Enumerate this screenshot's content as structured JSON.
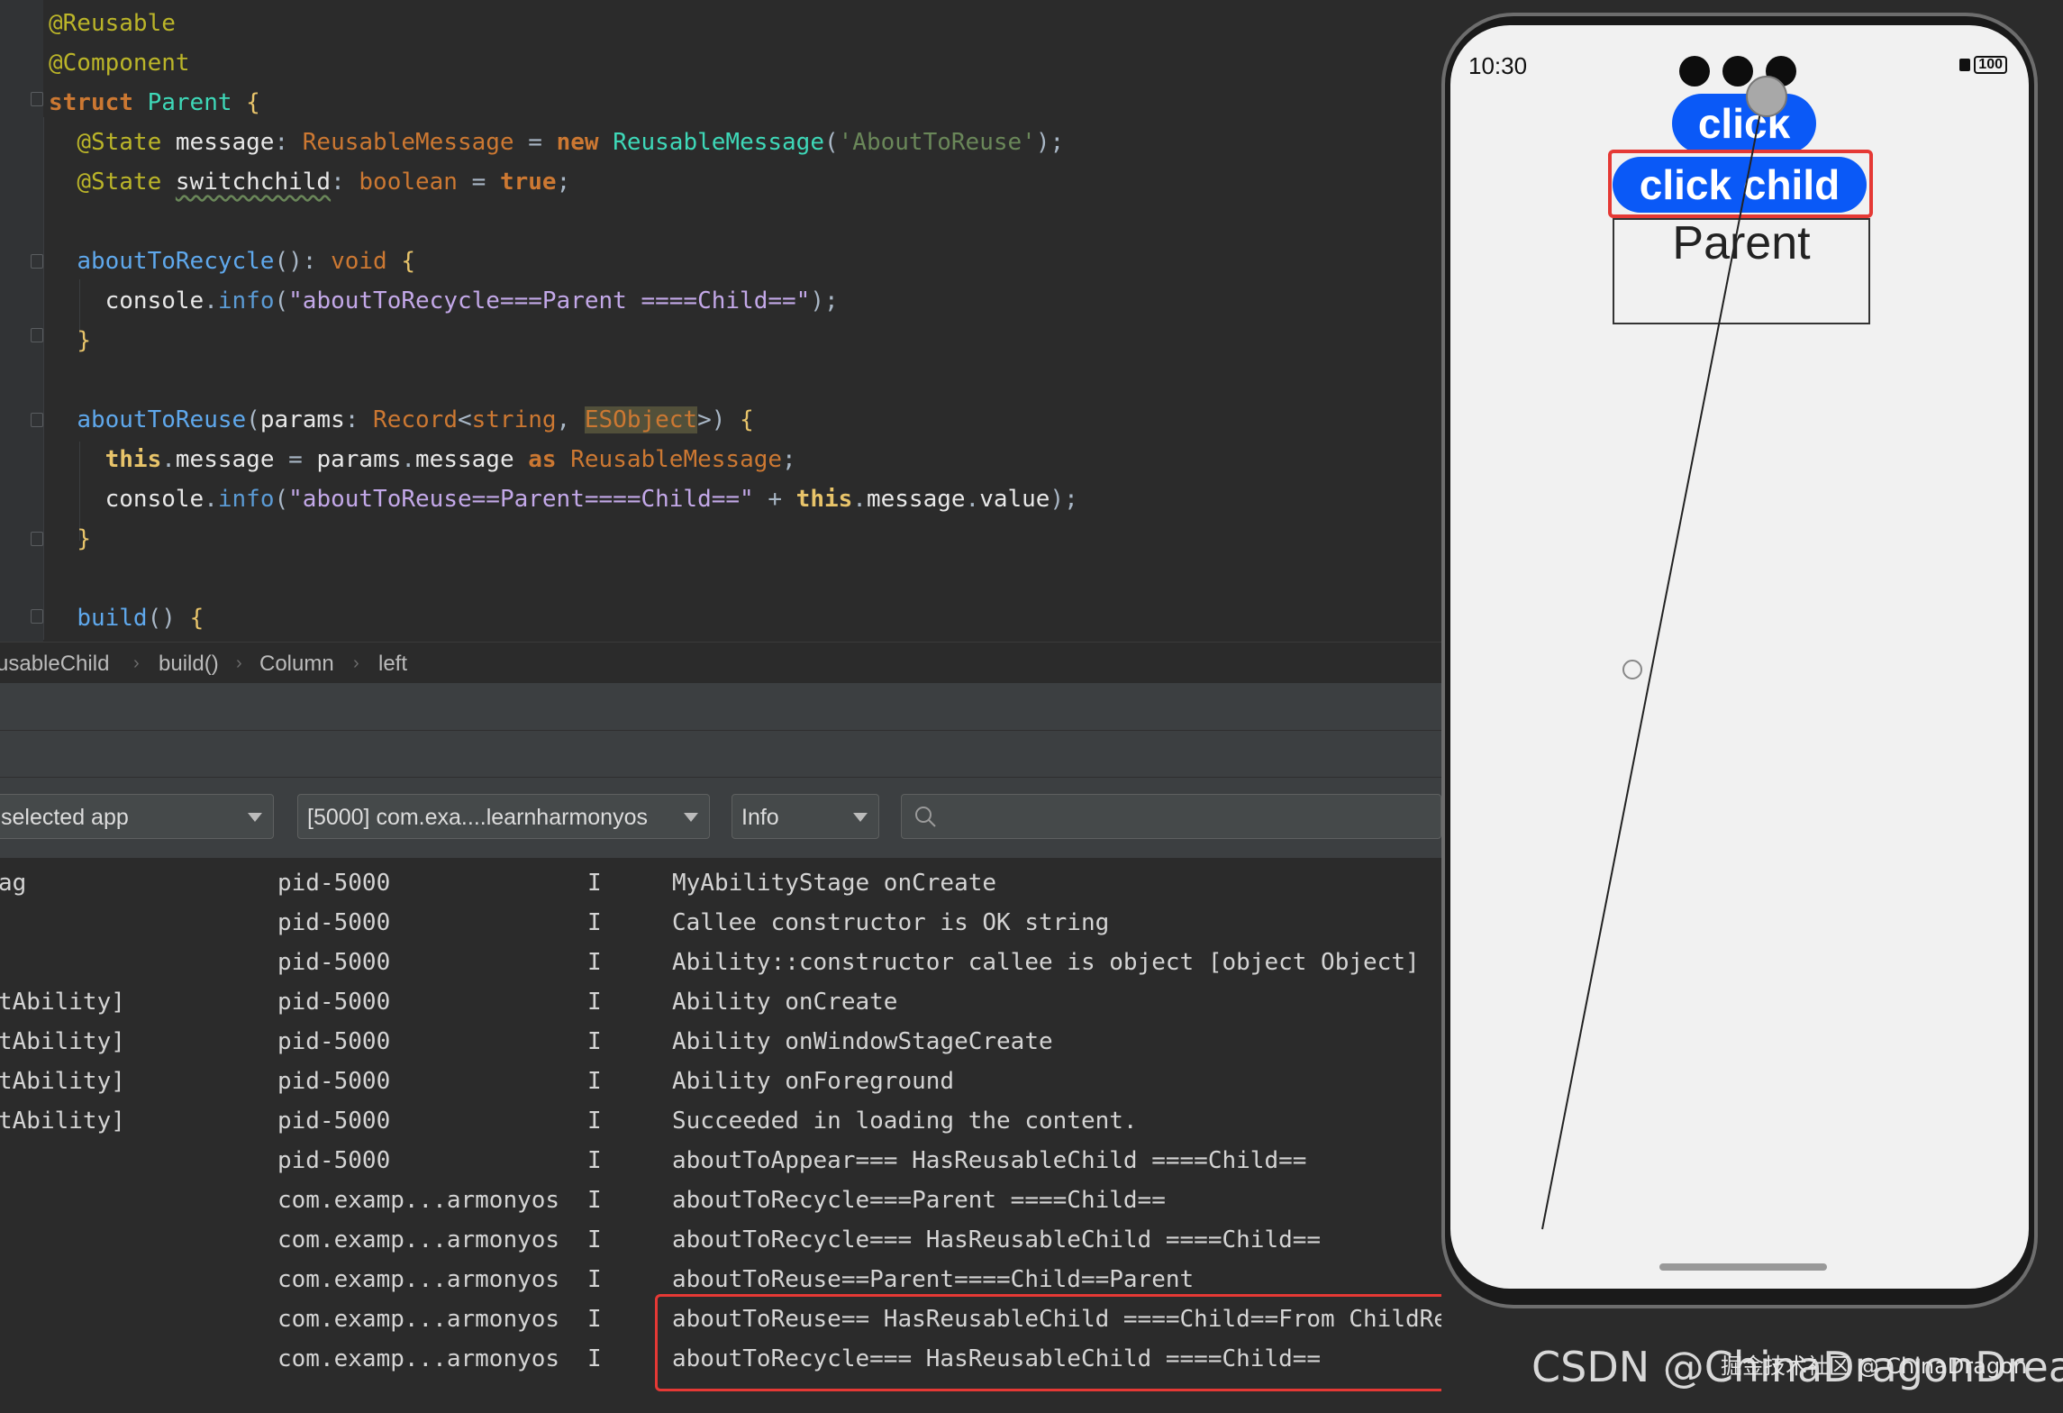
{
  "editor": {
    "lines": [
      {
        "parts": [
          {
            "t": "@Reusable",
            "c": "c-ann"
          }
        ]
      },
      {
        "parts": [
          {
            "t": "@Component",
            "c": "c-ann"
          }
        ]
      },
      {
        "parts": [
          {
            "t": "struct ",
            "c": "c-kw"
          },
          {
            "t": "Parent ",
            "c": "c-cls"
          },
          {
            "t": "{",
            "c": "c-brace"
          }
        ]
      },
      {
        "parts": [
          {
            "t": "  "
          },
          {
            "t": "@State ",
            "c": "c-ann"
          },
          {
            "t": "message",
            "c": "c-id"
          },
          {
            "t": ": "
          },
          {
            "t": "ReusableMessage",
            "c": "c-type"
          },
          {
            "t": " = "
          },
          {
            "t": "new ",
            "c": "c-kw"
          },
          {
            "t": "ReusableMessage",
            "c": "c-cls"
          },
          {
            "t": "("
          },
          {
            "t": "'AboutToReuse'",
            "c": "c-str"
          },
          {
            "t": ");"
          }
        ]
      },
      {
        "parts": [
          {
            "t": "  "
          },
          {
            "t": "@State ",
            "c": "c-ann"
          },
          {
            "t": "switchchild",
            "c": "c-id squiggle"
          },
          {
            "t": ": "
          },
          {
            "t": "boolean",
            "c": "c-kw2"
          },
          {
            "t": " = "
          },
          {
            "t": "true",
            "c": "c-kw"
          },
          {
            "t": ";"
          }
        ]
      },
      {
        "parts": []
      },
      {
        "parts": [
          {
            "t": "  "
          },
          {
            "t": "aboutToRecycle",
            "c": "c-pname"
          },
          {
            "t": "(): "
          },
          {
            "t": "void ",
            "c": "c-kw2"
          },
          {
            "t": "{",
            "c": "c-brace"
          }
        ]
      },
      {
        "parts": [
          {
            "t": "    "
          },
          {
            "t": "console",
            "c": "c-id"
          },
          {
            "t": "."
          },
          {
            "t": "info",
            "c": "c-fn"
          },
          {
            "t": "("
          },
          {
            "t": "\"aboutToRecycle===Parent ====Child==\"",
            "c": "c-str2"
          },
          {
            "t": ");"
          }
        ]
      },
      {
        "parts": [
          {
            "t": "  "
          },
          {
            "t": "}",
            "c": "c-brace"
          }
        ]
      },
      {
        "parts": []
      },
      {
        "parts": [
          {
            "t": "  "
          },
          {
            "t": "aboutToReuse",
            "c": "c-pname"
          },
          {
            "t": "("
          },
          {
            "t": "params",
            "c": "c-id"
          },
          {
            "t": ": "
          },
          {
            "t": "Record",
            "c": "c-type"
          },
          {
            "t": "<"
          },
          {
            "t": "string",
            "c": "c-kw2"
          },
          {
            "t": ", "
          },
          {
            "t": "ESObject",
            "c": "hl-es"
          },
          {
            "t": ">) "
          },
          {
            "t": "{",
            "c": "c-brace"
          }
        ]
      },
      {
        "parts": [
          {
            "t": "    "
          },
          {
            "t": "this",
            "c": "c-this"
          },
          {
            "t": "."
          },
          {
            "t": "message",
            "c": "c-id"
          },
          {
            "t": " = "
          },
          {
            "t": "params",
            "c": "c-id"
          },
          {
            "t": "."
          },
          {
            "t": "message",
            "c": "c-id"
          },
          {
            "t": " "
          },
          {
            "t": "as ",
            "c": "c-kw"
          },
          {
            "t": "ReusableMessage",
            "c": "c-type"
          },
          {
            "t": ";"
          }
        ]
      },
      {
        "parts": [
          {
            "t": "    "
          },
          {
            "t": "console",
            "c": "c-id"
          },
          {
            "t": "."
          },
          {
            "t": "info",
            "c": "c-fn"
          },
          {
            "t": "("
          },
          {
            "t": "\"aboutToReuse==Parent====Child==\"",
            "c": "c-str2"
          },
          {
            "t": " + "
          },
          {
            "t": "this",
            "c": "c-this"
          },
          {
            "t": "."
          },
          {
            "t": "message",
            "c": "c-id"
          },
          {
            "t": "."
          },
          {
            "t": "value",
            "c": "c-id"
          },
          {
            "t": ");"
          }
        ]
      },
      {
        "parts": [
          {
            "t": "  "
          },
          {
            "t": "}",
            "c": "c-brace"
          }
        ]
      },
      {
        "parts": []
      },
      {
        "parts": [
          {
            "t": "  "
          },
          {
            "t": "build",
            "c": "c-pname"
          },
          {
            "t": "() "
          },
          {
            "t": "{",
            "c": "c-brace"
          }
        ]
      }
    ]
  },
  "breadcrumb": {
    "items": [
      "usableChild",
      "build()",
      "Column",
      "left"
    ],
    "sep": "›"
  },
  "log_toolbar": {
    "app_select": "selected app",
    "process_select": "[5000] com.exa....learnharmonyos",
    "level_select": "Info",
    "search_icon": "search-icon"
  },
  "log": {
    "rows": [
      {
        "tag": "ag",
        "pid": "pid-5000",
        "level": "I",
        "msg": "MyAbilityStage onCreate"
      },
      {
        "tag": "",
        "pid": "pid-5000",
        "level": "I",
        "msg": "Callee constructor is OK string"
      },
      {
        "tag": "",
        "pid": "pid-5000",
        "level": "I",
        "msg": "Ability::constructor callee is object [object Object]"
      },
      {
        "tag": "tAbility]",
        "pid": "pid-5000",
        "level": "I",
        "msg": "Ability onCreate"
      },
      {
        "tag": "tAbility]",
        "pid": "pid-5000",
        "level": "I",
        "msg": "Ability onWindowStageCreate"
      },
      {
        "tag": "tAbility]",
        "pid": "pid-5000",
        "level": "I",
        "msg": "Ability onForeground"
      },
      {
        "tag": "tAbility]",
        "pid": "pid-5000",
        "level": "I",
        "msg": "Succeeded in loading the content."
      },
      {
        "tag": "",
        "pid": "pid-5000",
        "level": "I",
        "msg": "aboutToAppear=== HasReusableChild ====Child=="
      },
      {
        "tag": "",
        "pid": "com.examp...armonyos",
        "level": "I",
        "msg": "aboutToRecycle===Parent ====Child=="
      },
      {
        "tag": "",
        "pid": "com.examp...armonyos",
        "level": "I",
        "msg": "aboutToRecycle=== HasReusableChild ====Child=="
      },
      {
        "tag": "",
        "pid": "com.examp...armonyos",
        "level": "I",
        "msg": "aboutToReuse==Parent====Child==Parent"
      },
      {
        "tag": "",
        "pid": "com.examp...armonyos",
        "level": "I",
        "msg": "aboutToReuse== HasReusableChild ====Child==From ChildReuse"
      },
      {
        "tag": "",
        "pid": "com.examp...armonyos",
        "level": "I",
        "msg": "aboutToRecycle=== HasReusableChild ====Child=="
      }
    ]
  },
  "phone": {
    "time": "10:30",
    "battery": "100",
    "click_label": "click",
    "click_child_label": "click child",
    "parent_label": "Parent"
  },
  "watermark": {
    "main": "CSDN @ChinaDragonDreamer",
    "overlay": "掘金技术社区 @ ChinaDragon"
  },
  "colors": {
    "accent": "#0a59f7",
    "highlight": "#e53935",
    "editor_bg": "#2b2b2b"
  }
}
